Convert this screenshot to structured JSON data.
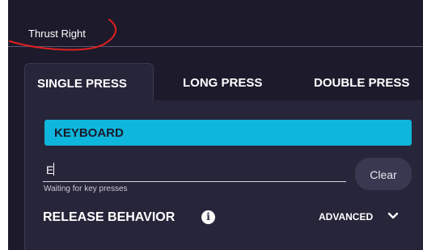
{
  "binding": {
    "name": "Thrust Right"
  },
  "tabs": [
    {
      "label": "SINGLE PRESS",
      "active": true
    },
    {
      "label": "LONG PRESS",
      "active": false
    },
    {
      "label": "DOUBLE PRESS",
      "active": false
    }
  ],
  "panel": {
    "device_label": "KEYBOARD",
    "key_input_value": "E",
    "helper_text": "Waiting for key presses",
    "clear_label": "Clear",
    "release_heading": "RELEASE BEHAVIOR",
    "info_icon": "i",
    "advanced_label": "ADVANCED"
  },
  "icons": {
    "info": "info-icon",
    "advanced": "chevron-down-icon"
  },
  "colors": {
    "background": "#1c1a2b",
    "panel": "#272539",
    "accent": "#0eb5dc",
    "annotation": "#e02020"
  }
}
